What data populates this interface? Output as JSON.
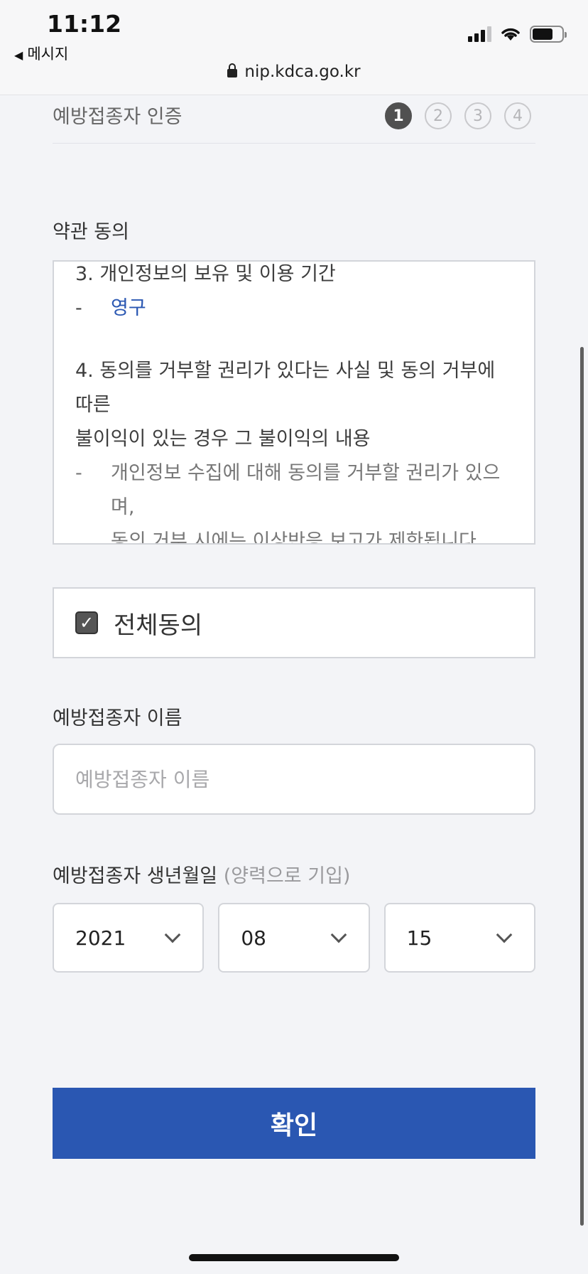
{
  "status_bar": {
    "time": "11:12",
    "back_label": "메시지",
    "url": "nip.kdca.go.kr"
  },
  "header": {
    "title": "예방접종자 인증",
    "steps": [
      "1",
      "2",
      "3",
      "4"
    ],
    "active_step": "1"
  },
  "terms": {
    "section_label": "약관 동의",
    "item3_heading": "3. 개인정보의 보유 및 이용 기간",
    "item3_value": "영구",
    "item4_heading_line1": "4. 동의를 거부할 권리가 있다는 사실 및 동의 거부에 따른",
    "item4_heading_line2": "불이익이 있는 경우 그 불이익의 내용",
    "item4_detail_line1": "개인정보 수집에 대해 동의를 거부할 권리가 있으며,",
    "item4_detail_line2": "동의 거부 시에는 이상반응 보고가 제한됩니다.",
    "dash": "-"
  },
  "agree_all": {
    "label": "전체동의",
    "checked": true
  },
  "name_field": {
    "label": "예방접종자 이름",
    "placeholder": "예방접종자 이름",
    "value": ""
  },
  "birth": {
    "label": "예방접종자 생년월일",
    "hint": "(양력으로 기입)",
    "year": "2021",
    "month": "08",
    "day": "15"
  },
  "confirm_label": "확인",
  "colors": {
    "primary": "#2a57b2",
    "background": "#f3f4f7",
    "active_step": "#505050"
  }
}
